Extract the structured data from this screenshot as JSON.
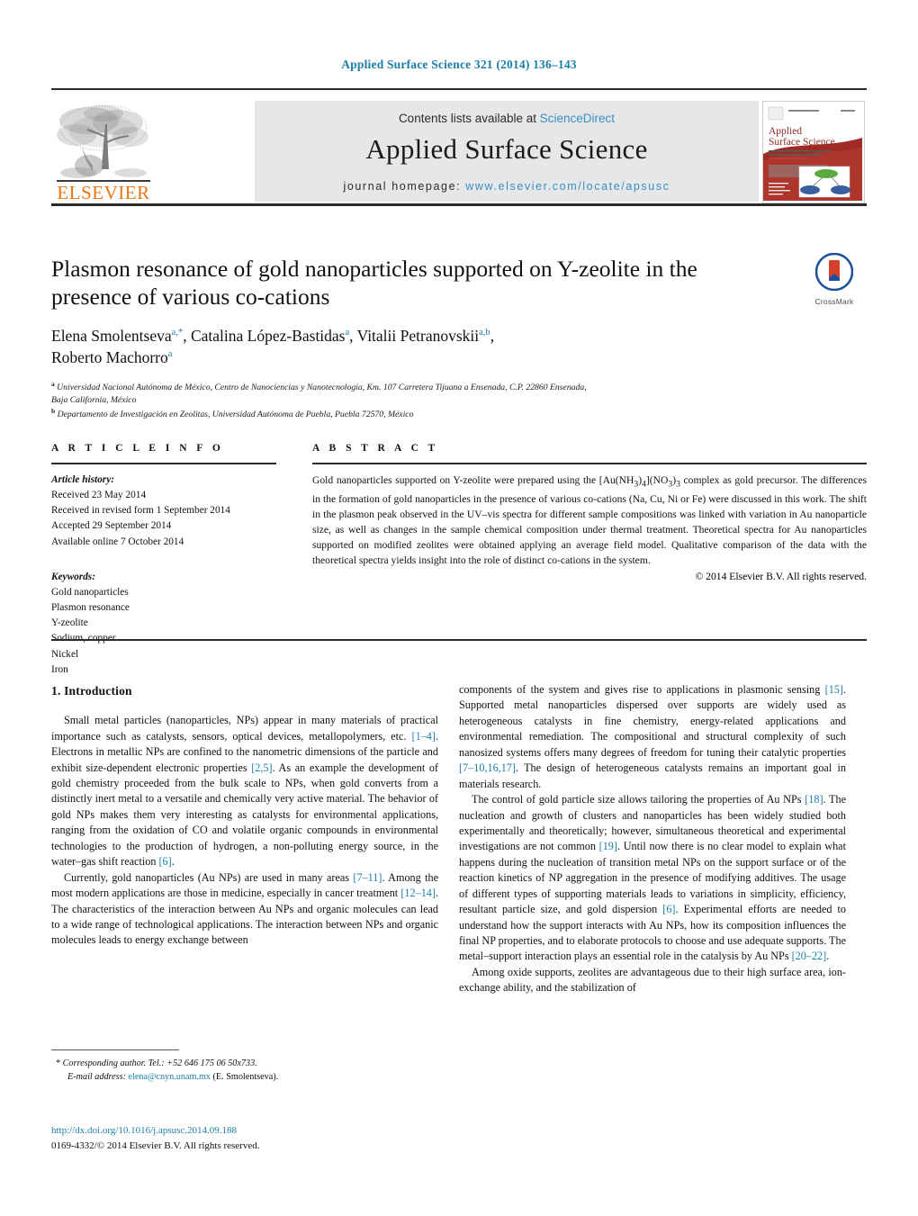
{
  "running_head": "Applied Surface Science 321 (2014) 136–143",
  "masthead": {
    "contents_prefix": "Contents lists available at ",
    "sciencedirect": "ScienceDirect",
    "journal_name": "Applied Surface Science",
    "homepage_label": "journal homepage:",
    "homepage_url": "www.elsevier.com/locate/apsusc",
    "publisher": "ELSEVIER",
    "cover_title_line1": "Applied",
    "cover_title_line2": "Surface Science"
  },
  "article": {
    "title": "Plasmon resonance of gold nanoparticles supported on Y-zeolite in the presence of various co-cations",
    "crossmark_label": "CrossMark",
    "authors_line1_a": "Elena Smolentseva",
    "authors_line1_a_sup": "a,*",
    "authors_line1_b": ", Catalina López-Bastidas",
    "authors_line1_b_sup": "a",
    "authors_line1_c": ", Vitalii Petranovskii",
    "authors_line1_c_sup": "a,b",
    "authors_line1_comma": ",",
    "authors_line2": "Roberto Machorro",
    "authors_line2_sup": "a",
    "affiliation_a_sup": "a",
    "affiliation_a": "Universidad Nacional Autónoma de México, Centro de Nanociencias y Nanotecnología, Km. 107 Carretera Tijuana a Ensenada, C.P. 22860 Ensenada,",
    "affiliation_a_cont": "Baja California, México",
    "affiliation_b_sup": "b",
    "affiliation_b": "Departamento de Investigación en Zeolitas, Universidad Autónoma de Puebla, Puebla 72570, México"
  },
  "article_info": {
    "heading": "A R T I C L E   I N F O",
    "history_label": "Article history:",
    "history": [
      "Received 23 May 2014",
      "Received in revised form 1 September 2014",
      "Accepted 29 September 2014",
      "Available online 7 October 2014"
    ],
    "keywords_label": "Keywords:",
    "keywords": [
      "Gold nanoparticles",
      "Plasmon resonance",
      "Y-zeolite",
      "Sodium, copper",
      "Nickel",
      "Iron"
    ]
  },
  "abstract": {
    "heading": "A B S T R A C T",
    "text_part1": "Gold nanoparticles supported on Y-zeolite were prepared using the [Au(NH",
    "formula_1": "3",
    "text_part2": ")",
    "formula_2": "4",
    "text_part3": "](NO",
    "formula_3": "3",
    "text_part4": ")",
    "formula_4": "3",
    "text_part5": " complex as gold precursor. The differences in the formation of gold nanoparticles in the presence of various co-cations (Na, Cu, Ni or Fe) were discussed in this work. The shift in the plasmon peak observed in the UV–vis spectra for different sample compositions was linked with variation in Au nanoparticle size, as well as changes in the sample chemical composition under thermal treatment. Theoretical spectra for Au nanoparticles supported on modified zeolites were obtained applying an average field model. Qualitative comparison of the data with the theoretical spectra yields insight into the role of distinct co-cations in the system.",
    "copyright": "© 2014 Elsevier B.V. All rights reserved."
  },
  "introduction": {
    "heading": "1. Introduction",
    "left_p1_a": "Small metal particles (nanoparticles, NPs) appear in many materials of practical importance such as catalysts, sensors, optical devices, metallopolymers, etc. ",
    "left_p1_ref1": "[1–4]",
    "left_p1_b": ". Electrons in metallic NPs are confined to the nanometric dimensions of the particle and exhibit size-dependent electronic properties ",
    "left_p1_ref2": "[2,5]",
    "left_p1_c": ". As an example the development of gold chemistry proceeded from the bulk scale to NPs, when gold converts from a distinctly inert metal to a versatile and chemically very active material. The behavior of gold NPs makes them very interesting as catalysts for environmental applications, ranging from the oxidation of CO and volatile organic compounds in environmental technologies to the production of hydrogen, a non-polluting energy source, in the water–gas shift reaction ",
    "left_p1_ref3": "[6]",
    "left_p1_d": ".",
    "left_p2_a": "Currently, gold nanoparticles (Au NPs) are used in many areas ",
    "left_p2_ref1": "[7–11]",
    "left_p2_b": ". Among the most modern applications are those in medicine, especially in cancer treatment ",
    "left_p2_ref2": "[12–14]",
    "left_p2_c": ". The characteristics of the interaction between Au NPs and organic molecules can lead to a wide range of technological applications. The interaction between NPs and organic molecules leads to energy exchange between",
    "right_p1_a": "components of the system and gives rise to applications in plasmonic sensing ",
    "right_p1_ref1": "[15]",
    "right_p1_b": ". Supported metal nanoparticles dispersed over supports are widely used as heterogeneous catalysts in fine chemistry, energy-related applications and environmental remediation. The compositional and structural complexity of such nanosized systems offers many degrees of freedom for tuning their catalytic properties ",
    "right_p1_ref2": "[7–10,16,17]",
    "right_p1_c": ". The design of heterogeneous catalysts remains an important goal in materials research.",
    "right_p2_a": "The control of gold particle size allows tailoring the properties of Au NPs ",
    "right_p2_ref1": "[18]",
    "right_p2_b": ". The nucleation and growth of clusters and nanoparticles has been widely studied both experimentally and theoretically; however, simultaneous theoretical and experimental investigations are not common ",
    "right_p2_ref2": "[19]",
    "right_p2_c": ". Until now there is no clear model to explain what happens during the nucleation of transition metal NPs on the support surface or of the reaction kinetics of NP aggregation in the presence of modifying additives. The usage of different types of supporting materials leads to variations in simplicity, efficiency, resultant particle size, and gold dispersion ",
    "right_p2_ref3": "[6]",
    "right_p2_d": ". Experimental efforts are needed to understand how the support interacts with Au NPs, how its composition influences the final NP properties, and to elaborate protocols to choose and use adequate supports. The metal–support interaction plays an essential role in the catalysis by Au NPs ",
    "right_p2_ref4": "[20–22]",
    "right_p2_e": ".",
    "right_p3": "Among oxide supports, zeolites are advantageous due to their high surface area, ion-exchange ability, and the stabilization of"
  },
  "footnotes": {
    "corresponding_star": "*",
    "corresponding_text": "Corresponding author. Tel.: +52 646 175 06 50x733.",
    "email_label": "E-mail address:",
    "email": "elena@cnyn.unam.mx",
    "email_owner": "(E. Smolentseva).",
    "doi_url": "http://dx.doi.org/10.1016/j.apsusc.2014.09.188",
    "issn_line": "0169-4332/© 2014 Elsevier B.V. All rights reserved."
  },
  "colors": {
    "link_blue": "#1a7fa8",
    "elsevier_orange": "#E87613",
    "band_gray": "#e6e7e8"
  }
}
